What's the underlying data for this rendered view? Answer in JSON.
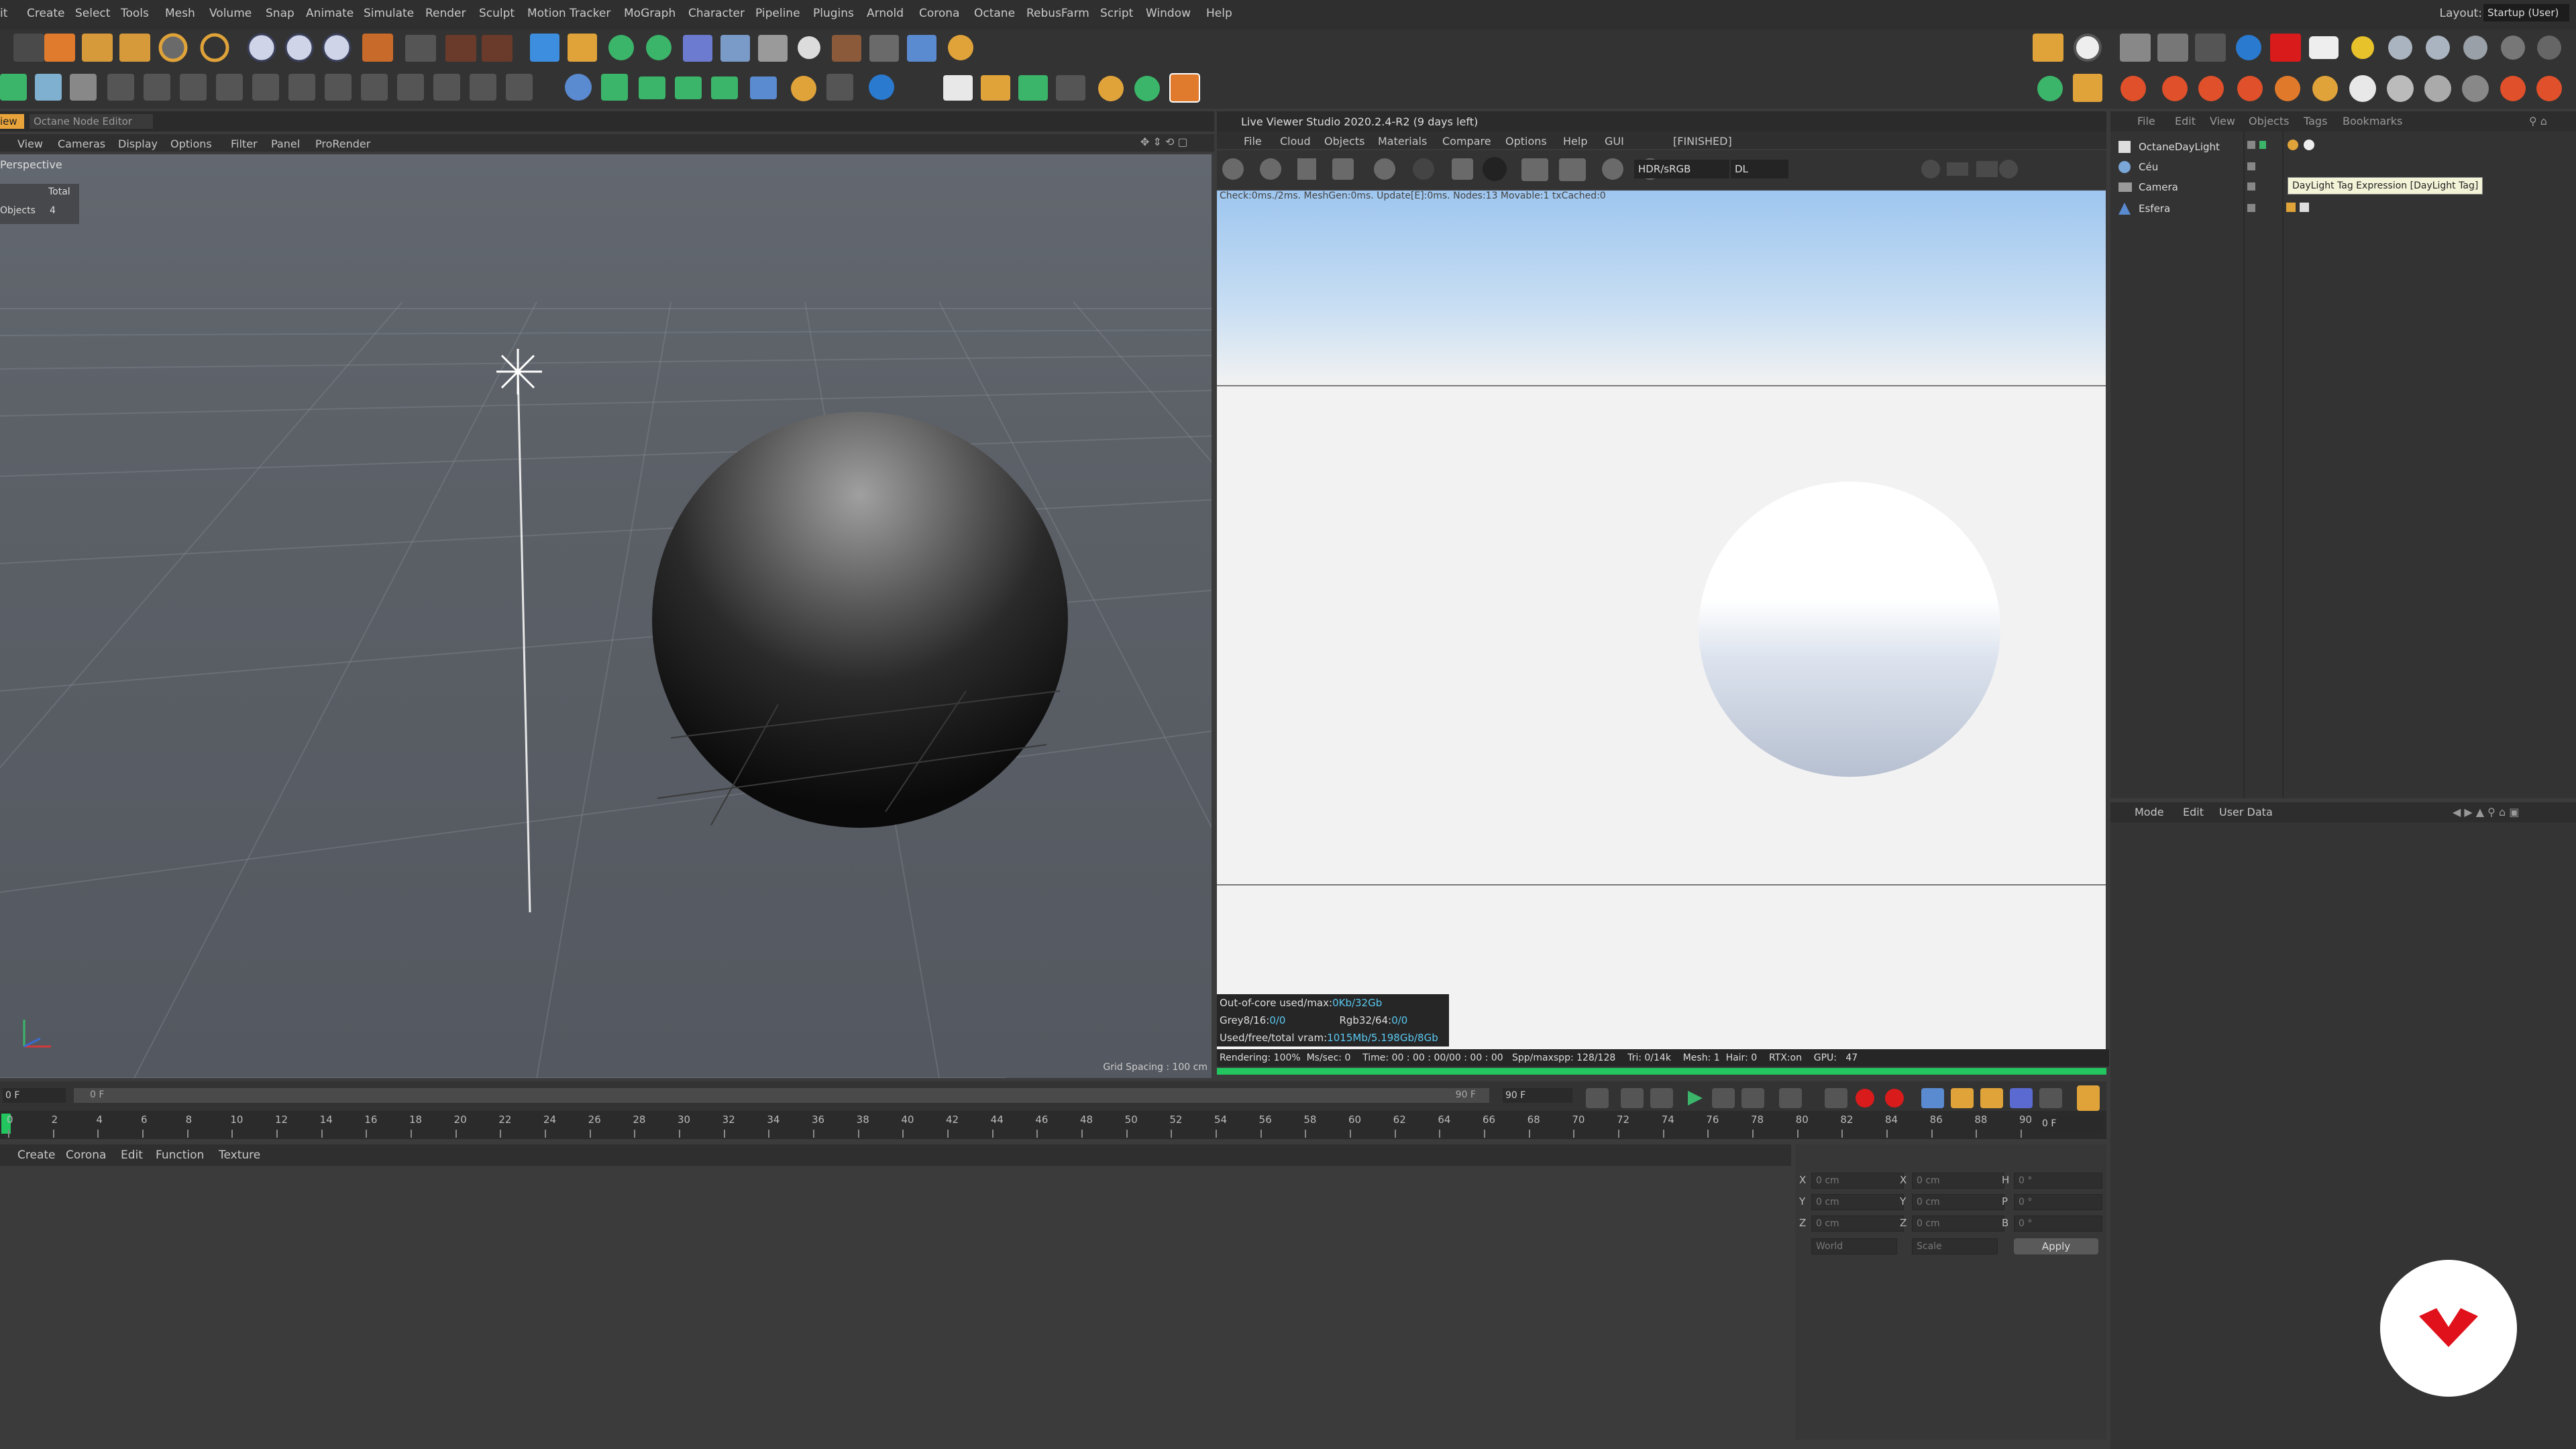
{
  "menubar": {
    "items": [
      "it",
      "Create",
      "Select",
      "Tools",
      "Mesh",
      "Volume",
      "Snap",
      "Animate",
      "Simulate",
      "Render",
      "Sculpt",
      "Motion Tracker",
      "MoGraph",
      "Character",
      "Pipeline",
      "Plugins",
      "Arnold",
      "Corona",
      "Octane",
      "RebusFarm",
      "Script",
      "Window",
      "Help"
    ],
    "layout_label": "Layout:",
    "layout_value": "Startup (User)"
  },
  "viewport": {
    "tabs": [
      "iew",
      "Octane Node Editor"
    ],
    "menu": [
      "View",
      "Cameras",
      "Display",
      "Options",
      "Filter",
      "Panel",
      "ProRender"
    ],
    "camera": "Perspective",
    "stats_header": "Total",
    "stats_label": "Objects",
    "stats_value": "4",
    "grid_spacing": "Grid Spacing : 100 cm"
  },
  "live_viewer": {
    "title": "Live Viewer Studio 2020.2.4-R2 (9 days left)",
    "menu": [
      "File",
      "Cloud",
      "Objects",
      "Materials",
      "Compare",
      "Options",
      "Help",
      "GUI"
    ],
    "status": "[FINISHED]",
    "mode": "HDR/sRGB",
    "channel": "DL",
    "check_line": "Check:0ms./2ms. MeshGen:0ms. Update[E]:0ms. Nodes:13 Movable:1 txCached:0",
    "out_of_core_label": "Out-of-core used/max:",
    "out_of_core_value": "0Kb/32Gb",
    "grey_label": "Grey8/16:",
    "grey_value": "0/0",
    "rgb_label": "Rgb32/64:",
    "rgb_value": "0/0",
    "vram_label": "Used/free/total vram:",
    "vram_value": "1015Mb/5.198Gb/8Gb",
    "render_status": "Rendering: 100%  Ms/sec: 0    Time: 00 : 00 : 00/00 : 00 : 00   Spp/maxspp: 128/128    Tri: 0/14k    Mesh: 1  Hair: 0    RTX:on    GPU:   47"
  },
  "object_manager": {
    "menu": [
      "File",
      "Edit",
      "View",
      "Objects",
      "Tags",
      "Bookmarks"
    ],
    "objects": [
      "OctaneDayLight",
      "Céu",
      "Camera",
      "Esfera"
    ],
    "tooltip": "DayLight Tag Expression [DayLight Tag]"
  },
  "attribute_manager": {
    "menu": [
      "Mode",
      "Edit",
      "User Data"
    ]
  },
  "timeline": {
    "start_frame": "0 F",
    "slider_start": "0 F",
    "slider_end": "90 F",
    "end_frame": "90 F",
    "current_frame": "0 F",
    "ticks": [
      "0",
      "2",
      "4",
      "6",
      "8",
      "10",
      "12",
      "14",
      "16",
      "18",
      "20",
      "22",
      "24",
      "26",
      "28",
      "30",
      "32",
      "34",
      "36",
      "38",
      "40",
      "42",
      "44",
      "46",
      "48",
      "50",
      "52",
      "54",
      "56",
      "58",
      "60",
      "62",
      "64",
      "66",
      "68",
      "70",
      "72",
      "74",
      "76",
      "78",
      "80",
      "82",
      "84",
      "86",
      "88",
      "90"
    ]
  },
  "material_manager": {
    "menu": [
      "Create",
      "Corona",
      "Edit",
      "Function",
      "Texture"
    ]
  },
  "coordinates": {
    "pos_labels": [
      "X",
      "Y",
      "Z"
    ],
    "pos_values": [
      "0 cm",
      "0 cm",
      "0 cm"
    ],
    "size_labels": [
      "X",
      "Y",
      "Z"
    ],
    "size_values": [
      "0 cm",
      "0 cm",
      "0 cm"
    ],
    "rot_labels": [
      "H",
      "P",
      "B"
    ],
    "rot_values": [
      "0 °",
      "0 °",
      "0 °"
    ],
    "space": "World",
    "mode": "Scale",
    "apply": "Apply"
  },
  "colors": {
    "accent_orange": "#e8a33a",
    "render_ok_green": "#22c55e",
    "logo_red": "#e0111b"
  }
}
